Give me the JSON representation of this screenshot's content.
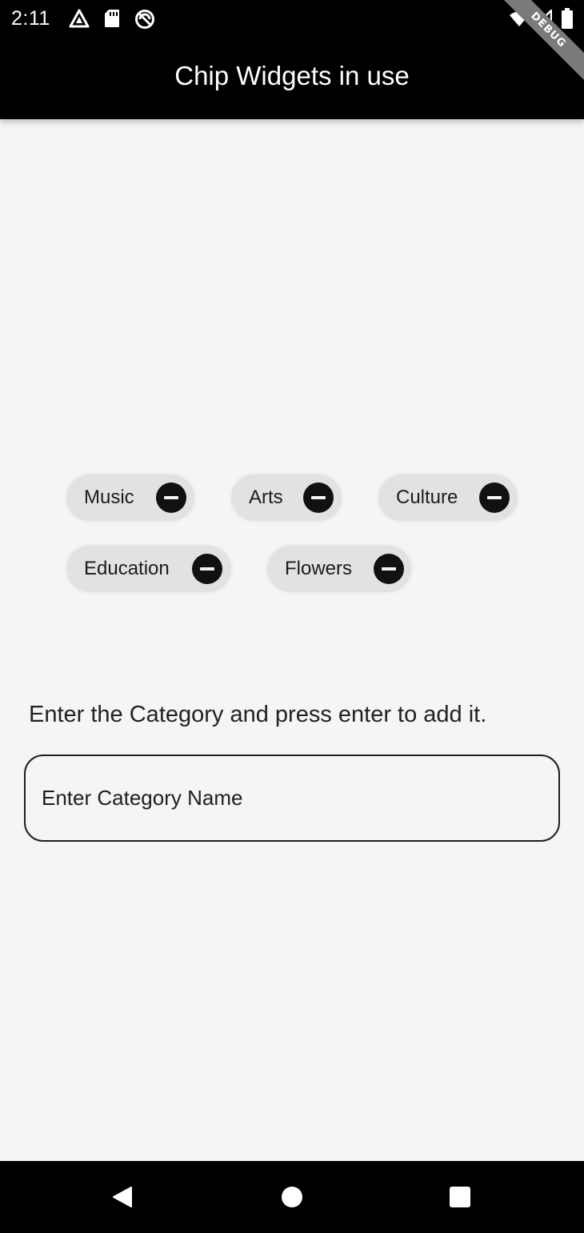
{
  "status_bar": {
    "time": "2:11",
    "icons": [
      "navigation-arrow-icon",
      "sd-card-icon",
      "do-not-disturb-icon",
      "wifi-icon",
      "signal-icon",
      "battery-icon"
    ]
  },
  "app_bar": {
    "title": "Chip Widgets in use",
    "debug_banner": "DEBUG"
  },
  "chips": [
    {
      "label": "Music",
      "delete_icon": "remove-circle-icon"
    },
    {
      "label": "Arts",
      "delete_icon": "remove-circle-icon"
    },
    {
      "label": "Culture",
      "delete_icon": "remove-circle-icon"
    },
    {
      "label": "Education",
      "delete_icon": "remove-circle-icon"
    },
    {
      "label": "Flowers",
      "delete_icon": "remove-circle-icon"
    }
  ],
  "category_form": {
    "prompt": "Enter the Category and press enter to add it.",
    "input_value": "",
    "input_placeholder": "Enter Category Name"
  },
  "nav_bar": {
    "buttons": [
      "back-icon",
      "home-icon",
      "recents-icon"
    ]
  },
  "colors": {
    "app_bar": "#000000",
    "background": "#f6f5f4",
    "chip": "#e2e2e2",
    "chip_delete": "#111111"
  }
}
